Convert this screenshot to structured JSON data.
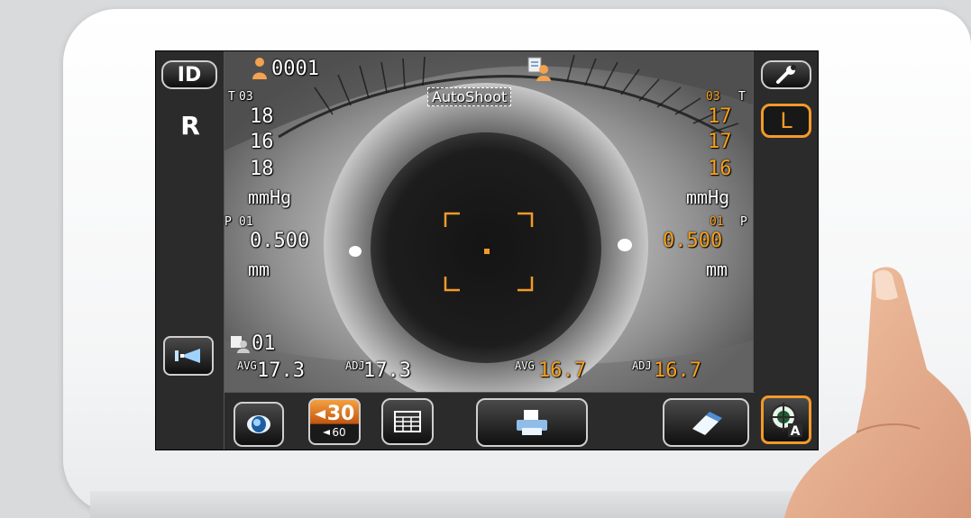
{
  "left_panel": {
    "id_button": "ID",
    "eye_side": "R"
  },
  "right_panel": {
    "eye_side_button": "L"
  },
  "patient": {
    "number": "0001"
  },
  "mode": {
    "label": "AutoShoot"
  },
  "right_eye": {
    "tonometry": {
      "tag": "T",
      "count": "03",
      "readings": [
        "18",
        "16",
        "18"
      ],
      "unit": "mmHg"
    },
    "pachymetry": {
      "tag": "P",
      "count": "01",
      "value": "0.500",
      "unit": "mm"
    },
    "summary": {
      "count": "01",
      "avg_label": "AVG",
      "avg": "17.3",
      "adj_label": "ADJ",
      "adj": "17.3"
    }
  },
  "left_eye": {
    "tonometry": {
      "tag": "T",
      "count": "03",
      "readings": [
        "17",
        "17",
        "16"
      ],
      "unit": "mmHg"
    },
    "pachymetry": {
      "tag": "P",
      "count": "01",
      "value": "0.500",
      "unit": "mm"
    },
    "summary": {
      "avg_label": "AVG",
      "avg": "16.7",
      "adj_label": "ADJ",
      "adj": "16.7"
    }
  },
  "bottom_bar": {
    "count_main": "30",
    "count_secondary": "60"
  },
  "colors": {
    "accent": "#f39a2a",
    "screen_bg": "#2b2b2b",
    "text": "#ffffff"
  },
  "icons": [
    "person-icon",
    "patient-card-icon",
    "wrench-icon",
    "light-icon",
    "eye-icon",
    "table-icon",
    "printer-icon",
    "eraser-icon",
    "target-auto-icon"
  ]
}
